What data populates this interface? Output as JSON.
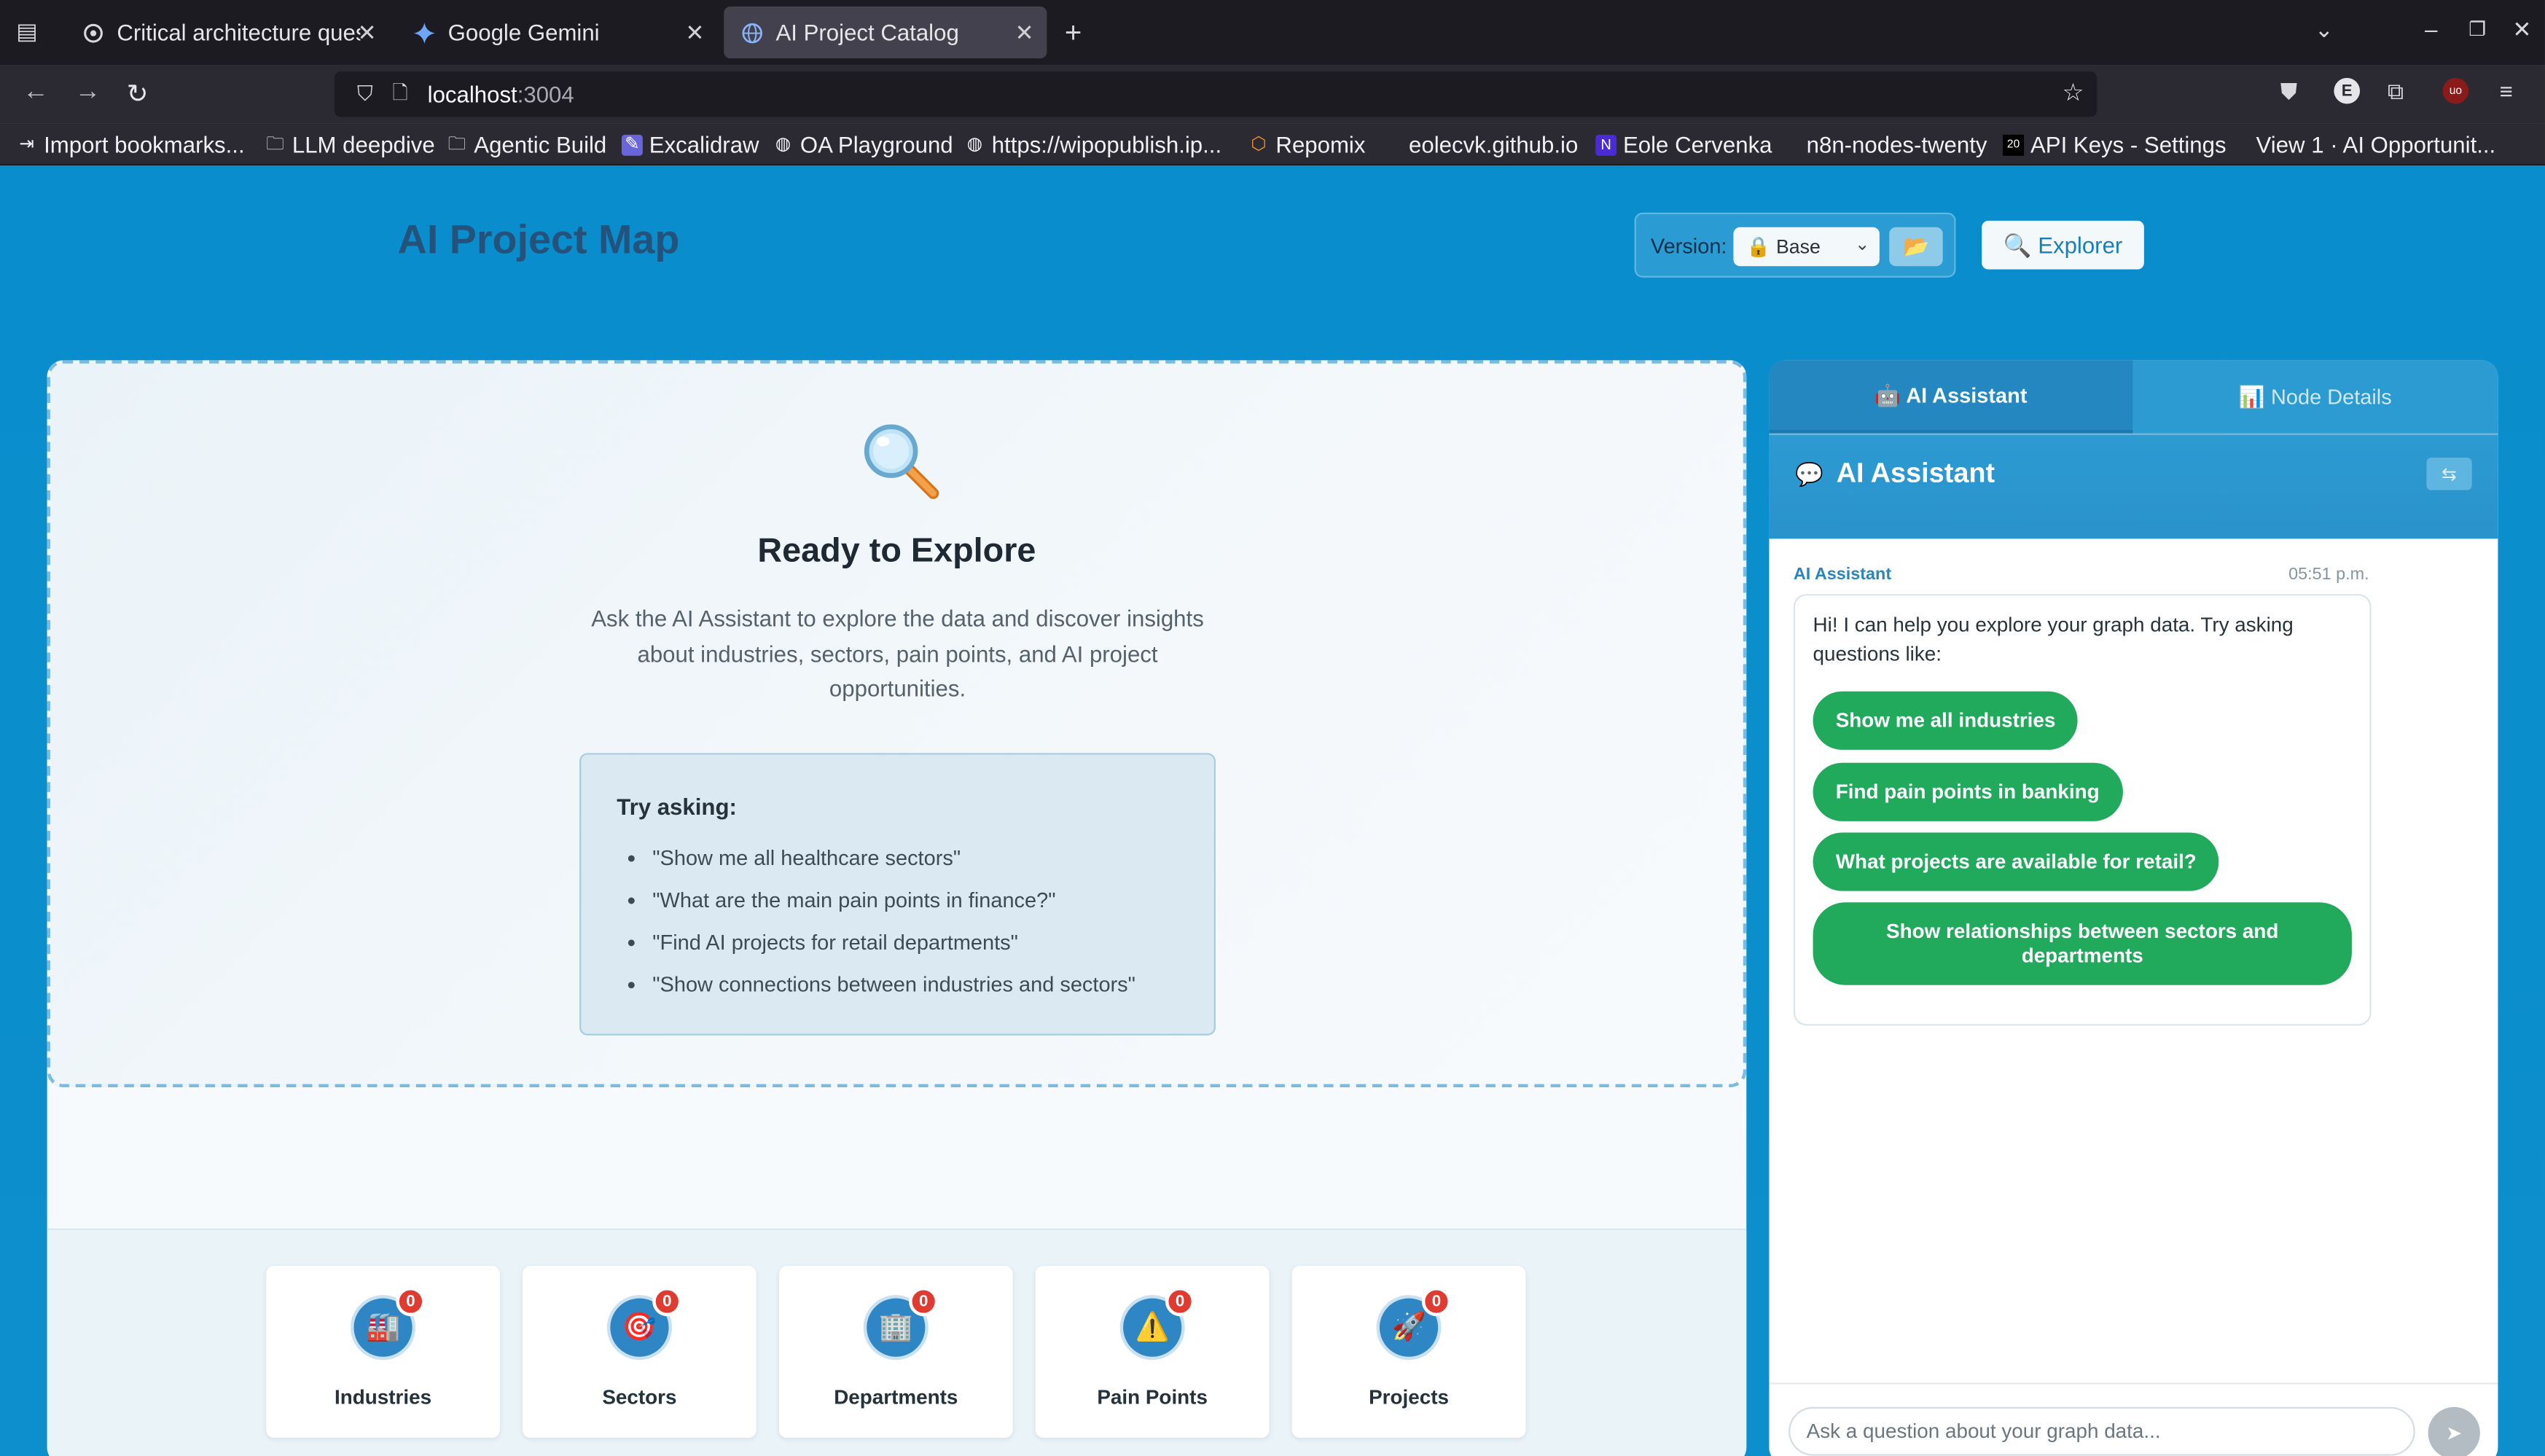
{
  "browser": {
    "tabs": [
      {
        "title": "Critical architecture ques",
        "icon": "openai-icon",
        "active": false
      },
      {
        "title": "Google Gemini",
        "icon": "gemini-icon",
        "active": false
      },
      {
        "title": "AI Project Catalog",
        "icon": "globe-icon",
        "active": true
      }
    ],
    "url_host": "localhost",
    "url_port": ":3004",
    "bookmarks": [
      "Import bookmarks...",
      "LLM deepdive",
      "Agentic Build",
      "Excalidraw",
      "OA Playground",
      "https://wipopublish.ip...",
      "Repomix",
      "eolecvk.github.io",
      "Eole Cervenka",
      "n8n-nodes-twenty",
      "API Keys - Settings",
      "View 1 · AI Opportunit..."
    ]
  },
  "header": {
    "title": "AI Project Map",
    "version_label": "Version:",
    "version_value": "🔒 Base",
    "explorer_label": "🔍 Explorer"
  },
  "explore": {
    "title": "Ready to Explore",
    "description": "Ask the AI Assistant to explore the data and discover insights about industries, sectors, pain points, and AI project opportunities.",
    "try_title": "Try asking:",
    "examples": [
      "\"Show me all healthcare sectors\"",
      "\"What are the main pain points in finance?\"",
      "\"Find AI projects for retail departments\"",
      "\"Show connections between industries and sectors\""
    ]
  },
  "stats": [
    {
      "label": "Industries",
      "count": "0",
      "icon": "factory-icon",
      "glyph": "🏭"
    },
    {
      "label": "Sectors",
      "count": "0",
      "icon": "target-icon",
      "glyph": "🎯"
    },
    {
      "label": "Departments",
      "count": "0",
      "icon": "building-icon",
      "glyph": "🏢"
    },
    {
      "label": "Pain Points",
      "count": "0",
      "icon": "warning-icon",
      "glyph": "⚠️"
    },
    {
      "label": "Projects",
      "count": "0",
      "icon": "rocket-icon",
      "glyph": "🚀"
    }
  ],
  "side": {
    "tabs": [
      "🤖 AI Assistant",
      "📊 Node Details"
    ],
    "title": "AI Assistant",
    "message": {
      "sender": "AI Assistant",
      "time": "05:51 p.m.",
      "text": "Hi! I can help you explore your graph data. Try asking questions like:",
      "suggestions": [
        "Show me all industries",
        "Find pain points in banking",
        "What projects are available for retail?",
        "Show relationships between sectors and departments"
      ]
    },
    "input_placeholder": "Ask a question about your graph data..."
  },
  "colors": {
    "page_bg": "#0b8fcb",
    "title": "#24527a",
    "suggestion_green": "#21a95c",
    "badge_red": "#e03b31"
  }
}
